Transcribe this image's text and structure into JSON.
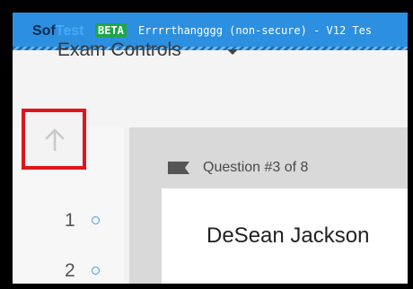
{
  "titlebar": {
    "logo_part1": "Sof",
    "logo_part2": "Test",
    "beta_badge": "BETA",
    "app_title": "Errrrthangggg (non-secure) - V12 Tes"
  },
  "toolbar": {
    "exam_controls_label": "Exam Controls",
    "dropdown_icon": "chevron-down-icon"
  },
  "sidebar": {
    "up_icon": "arrow-up-icon",
    "items": [
      {
        "number": "1",
        "status_icon": "circle-outline-icon"
      },
      {
        "number": "2",
        "status_icon": "circle-outline-icon"
      }
    ]
  },
  "question": {
    "flag_icon": "flag-icon",
    "header": "Question #3 of 8",
    "text": "DeSean Jackson"
  },
  "colors": {
    "titlebar": "#2d8fe0",
    "beta_badge": "#1ea64a",
    "highlight_box": "#e0151b",
    "status_dot": "#3a9bf0"
  }
}
